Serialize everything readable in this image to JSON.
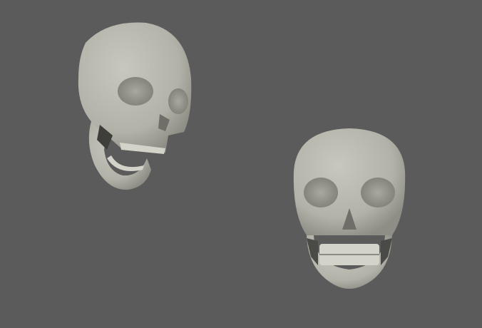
{
  "colors": {
    "background": "#5b5b5b",
    "bone": "#b9b8ae",
    "bone_shadow": "#8d8c84",
    "cavity": "#3e3e3a"
  },
  "objects": [
    {
      "name": "skull-open-jaw",
      "view": "three-quarter",
      "jaw": "open"
    },
    {
      "name": "skull-front",
      "view": "front",
      "jaw": "closed"
    }
  ]
}
